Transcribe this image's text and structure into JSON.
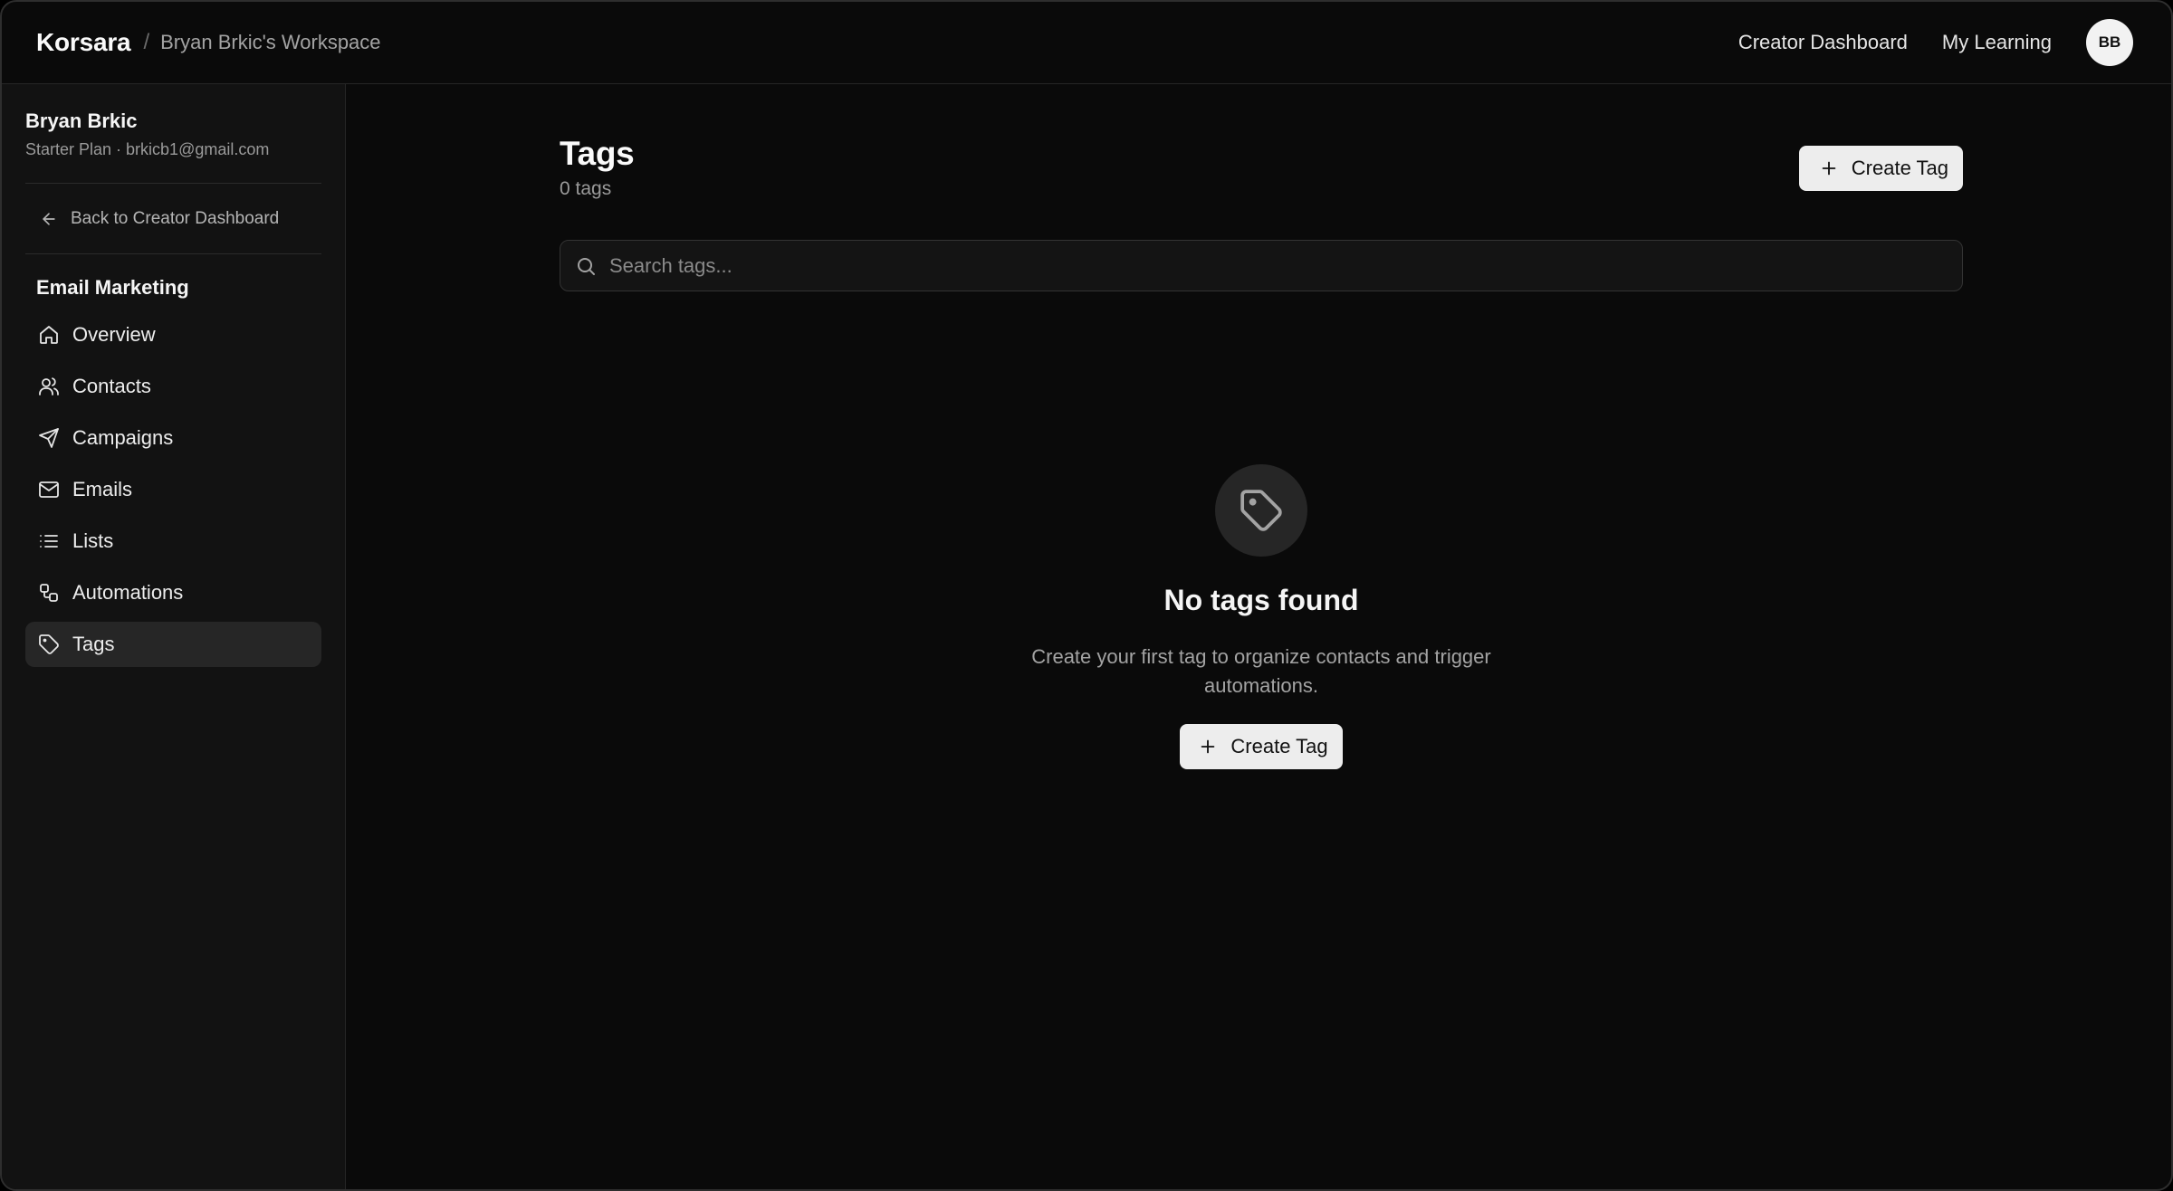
{
  "header": {
    "brand": "Korsara",
    "separator": "/",
    "workspace": "Bryan Brkic's Workspace",
    "links": [
      "Creator Dashboard",
      "My Learning"
    ],
    "avatar_initials": "BB"
  },
  "sidebar": {
    "user_name": "Bryan Brkic",
    "user_meta": "Starter Plan · brkicb1@gmail.com",
    "back_label": "Back to Creator Dashboard",
    "section_title": "Email Marketing",
    "items": [
      {
        "label": "Overview",
        "icon": "home-icon"
      },
      {
        "label": "Contacts",
        "icon": "users-icon"
      },
      {
        "label": "Campaigns",
        "icon": "send-icon"
      },
      {
        "label": "Emails",
        "icon": "mail-icon"
      },
      {
        "label": "Lists",
        "icon": "list-icon"
      },
      {
        "label": "Automations",
        "icon": "workflow-icon"
      },
      {
        "label": "Tags",
        "icon": "tag-icon",
        "active": true
      }
    ]
  },
  "main": {
    "title": "Tags",
    "count_label": "0 tags",
    "create_button_label": "Create Tag",
    "search_placeholder": "Search tags...",
    "empty_state": {
      "icon": "tag-icon",
      "title": "No tags found",
      "description": "Create your first tag to organize contacts and trigger automations.",
      "button_label": "Create Tag"
    }
  },
  "colors": {
    "background": "#0a0a0a",
    "sidebar": "#121212",
    "active_item": "#262626",
    "button": "#ededed"
  }
}
